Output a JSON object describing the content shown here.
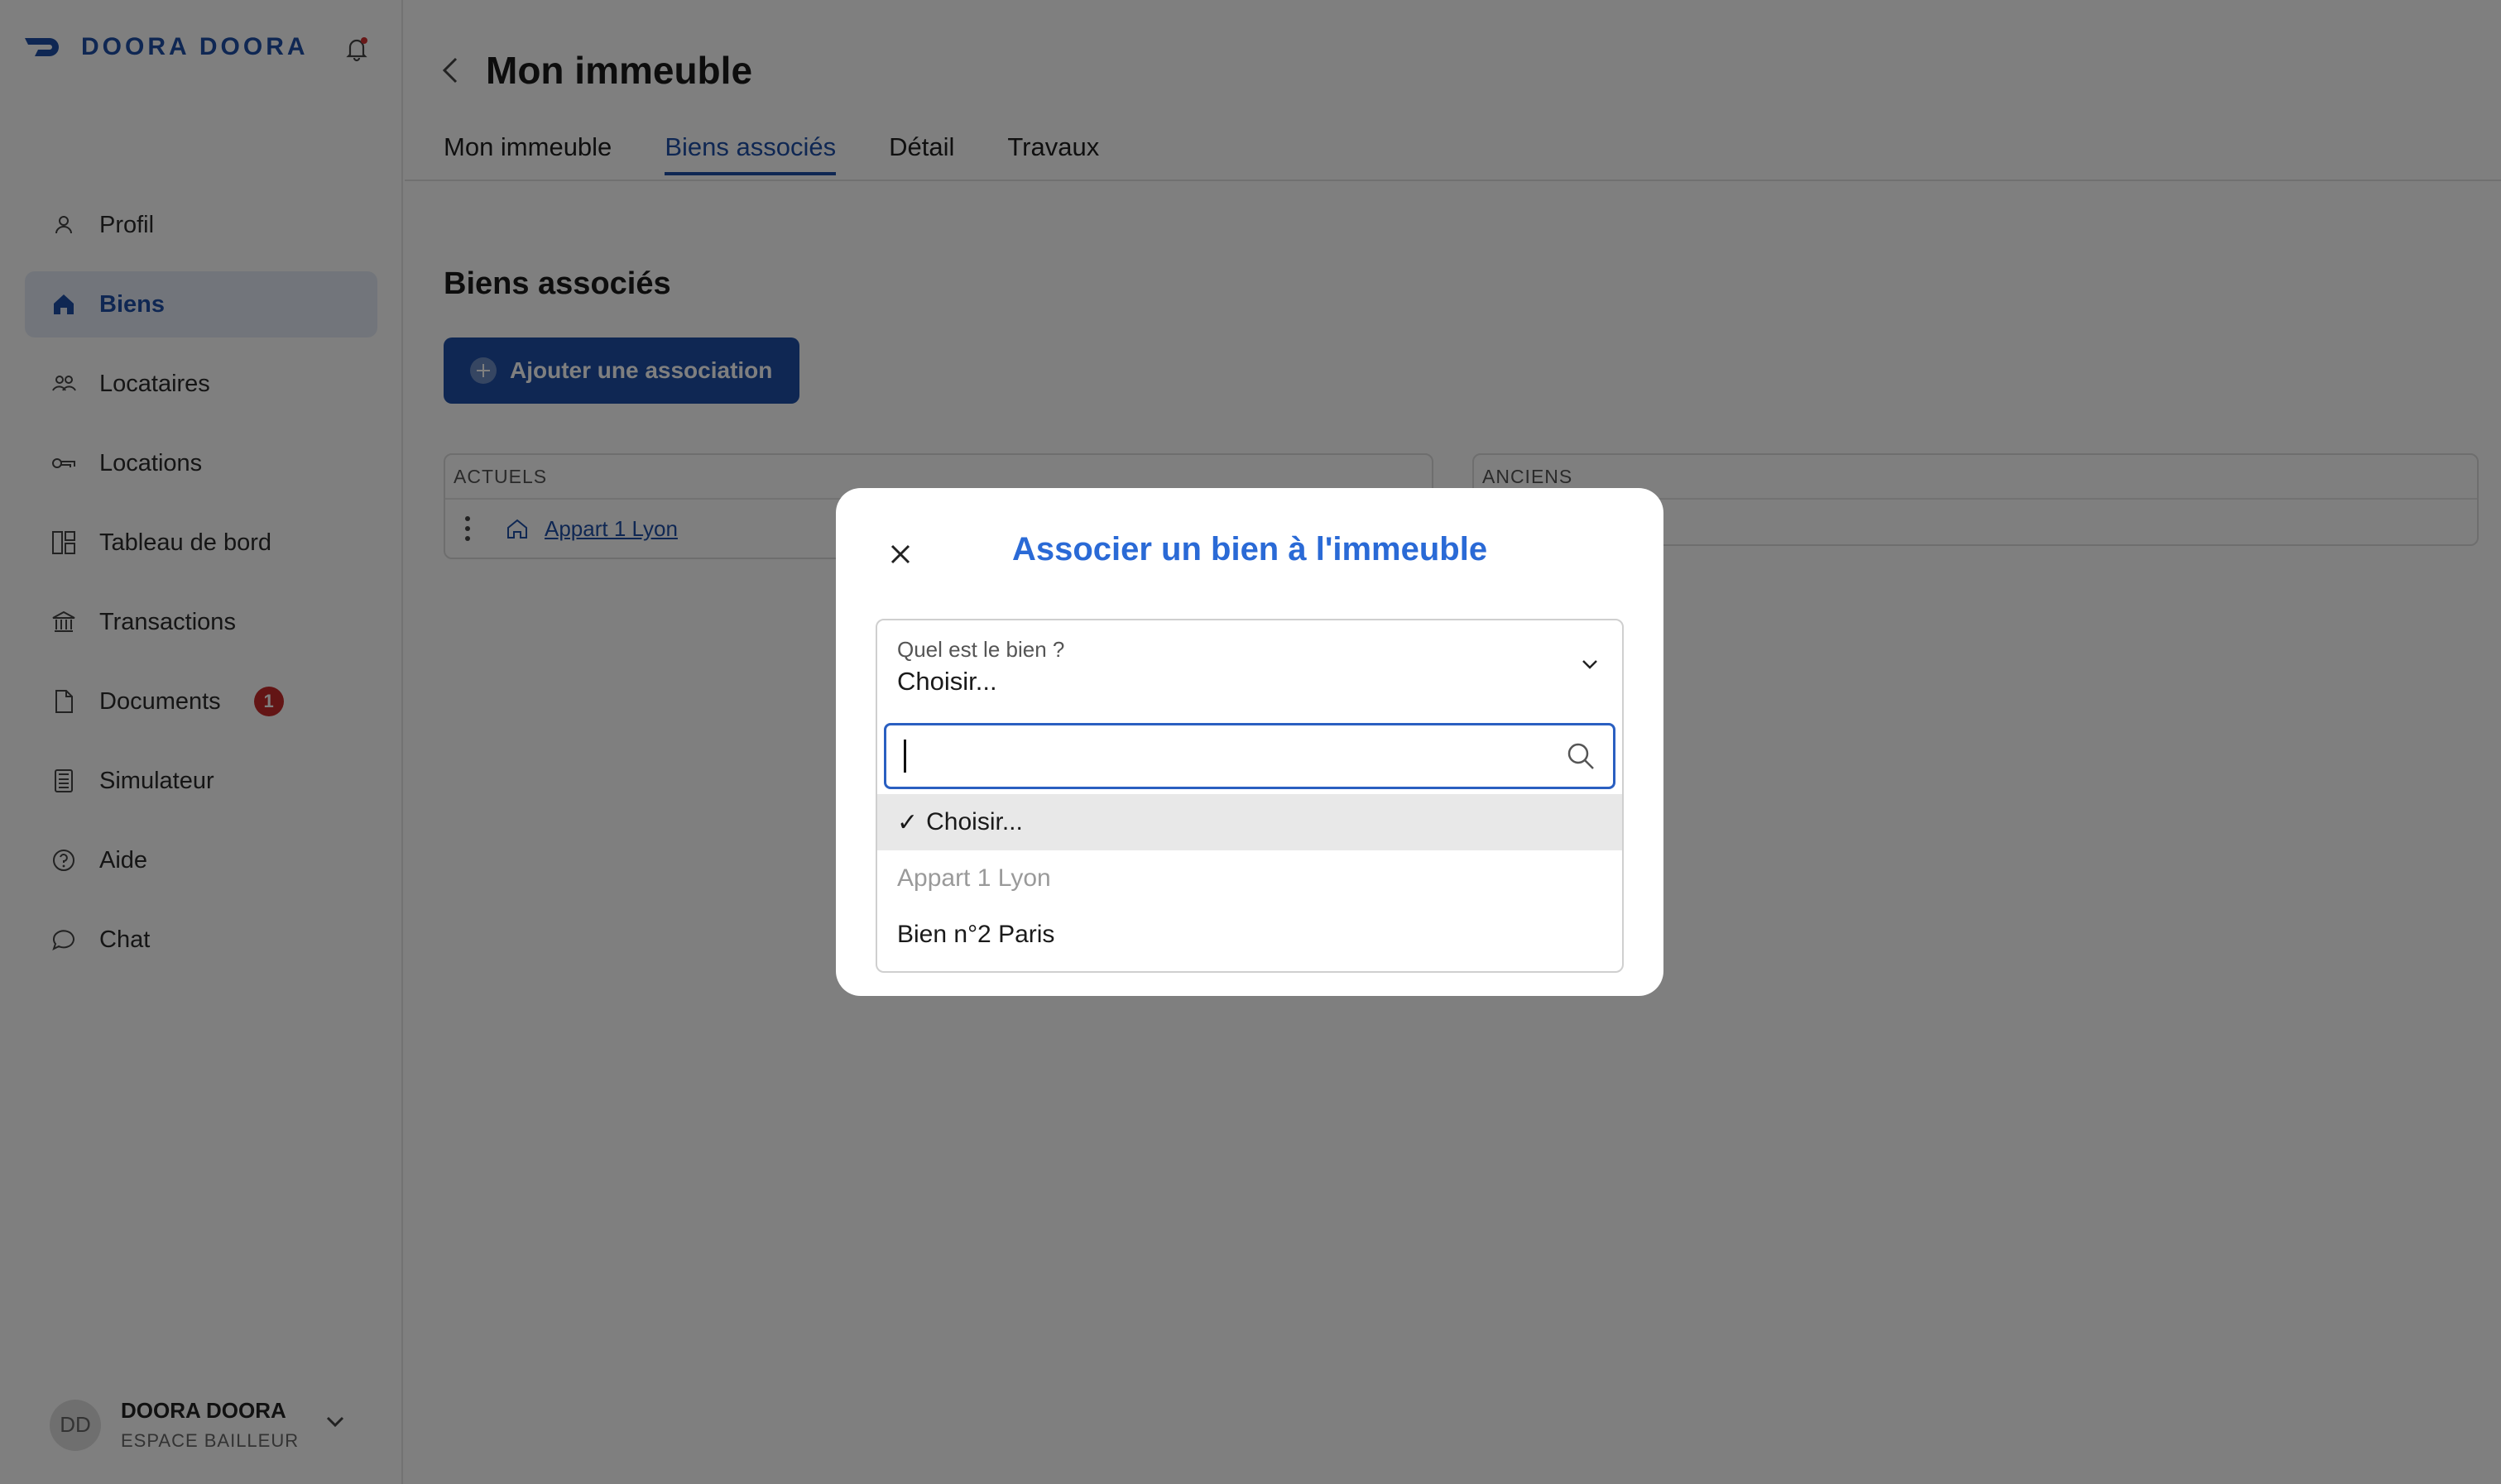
{
  "brand": {
    "name": "DOORA DOORA",
    "color": "#1e4fa6"
  },
  "sidebar": {
    "items": [
      {
        "label": "Profil",
        "icon": "person-icon"
      },
      {
        "label": "Biens",
        "icon": "home-icon",
        "active": true
      },
      {
        "label": "Locataires",
        "icon": "people-icon"
      },
      {
        "label": "Locations",
        "icon": "key-icon"
      },
      {
        "label": "Tableau de bord",
        "icon": "dashboard-icon"
      },
      {
        "label": "Transactions",
        "icon": "bank-icon"
      },
      {
        "label": "Documents",
        "icon": "document-icon",
        "badge": "1"
      },
      {
        "label": "Simulateur",
        "icon": "calculator-icon"
      },
      {
        "label": "Aide",
        "icon": "help-icon"
      },
      {
        "label": "Chat",
        "icon": "chat-icon"
      }
    ],
    "user": {
      "initials": "DD",
      "name": "DOORA DOORA",
      "role": "ESPACE BAILLEUR"
    }
  },
  "header": {
    "title": "Mon immeuble",
    "tabs": [
      {
        "label": "Mon immeuble"
      },
      {
        "label": "Biens associés",
        "active": true
      },
      {
        "label": "Détail"
      },
      {
        "label": "Travaux"
      }
    ]
  },
  "main": {
    "section_title": "Biens associés",
    "add_button": "Ajouter une association",
    "current_panel": {
      "header": "ACTUELS",
      "rows": [
        "Appart 1 Lyon"
      ]
    },
    "past_panel": {
      "header": "ANCIENS"
    }
  },
  "modal": {
    "title": "Associer un bien à l'immeuble",
    "select_label": "Quel est le bien ?",
    "select_value": "Choisir...",
    "search_value": "",
    "options": [
      {
        "label": "Choisir...",
        "selected": true
      },
      {
        "label": "Appart 1 Lyon",
        "disabled": true
      },
      {
        "label": "Bien n°2 Paris"
      }
    ]
  }
}
